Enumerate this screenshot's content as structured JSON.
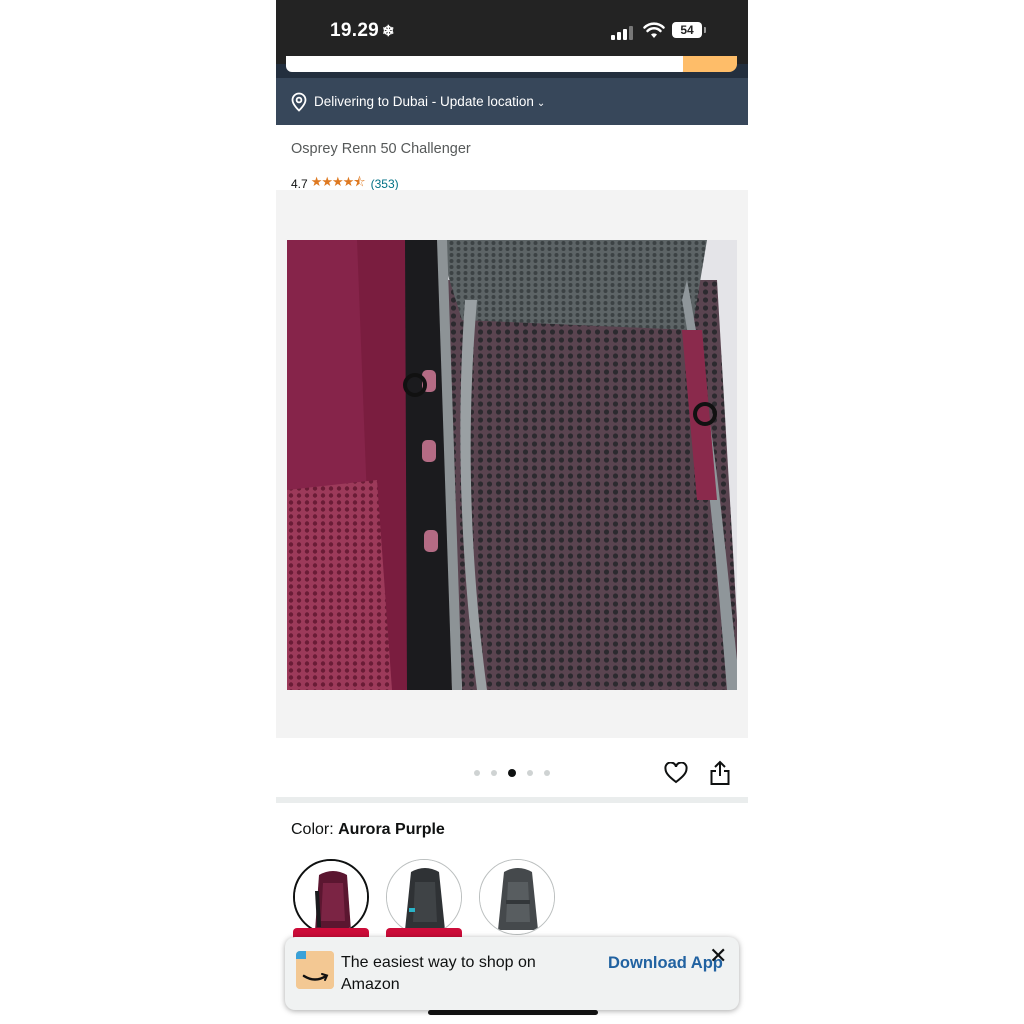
{
  "status_bar": {
    "time": "19.29",
    "time_suffix_icon": "snowflake-icon",
    "battery": "54",
    "icons": [
      "cellular-signal-icon",
      "wifi-icon",
      "battery-icon"
    ]
  },
  "location_bar": {
    "icon": "location-pin-icon",
    "text": "Delivering to Dubai - Update location",
    "chevron": "⌄"
  },
  "product": {
    "title": "Osprey Renn 50 Challenger",
    "rating": "4.7",
    "stars": "★★★★⯪",
    "review_count": "(353)"
  },
  "gallery": {
    "image_count": 5,
    "active_index": 2
  },
  "actions": {
    "wishlist_icon": "heart-icon",
    "share_icon": "share-icon"
  },
  "color": {
    "label": "Color: ",
    "selected": "Aurora Purple",
    "swatches": [
      "aurora-purple",
      "dark-grey",
      "grey"
    ]
  },
  "app_banner": {
    "text": "The easiest way to shop on Amazon",
    "cta": "Download App",
    "close": "✕"
  },
  "colors": {
    "header_dark": "#232f3e",
    "location_bar": "#37475a",
    "link": "#007185",
    "star": "#de7921",
    "cta": "#2162a1",
    "badge": "#cc0c39"
  }
}
